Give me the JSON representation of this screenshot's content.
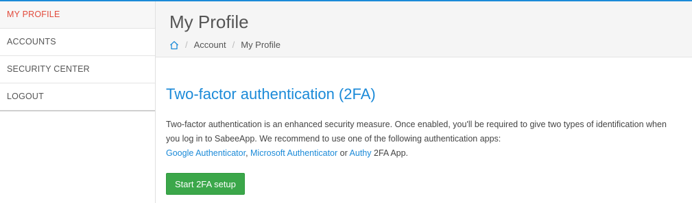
{
  "sidebar": {
    "items": [
      {
        "label": "MY PROFILE",
        "active": true
      },
      {
        "label": "ACCOUNTS",
        "active": false
      },
      {
        "label": "SECURITY CENTER",
        "active": false
      },
      {
        "label": "LOGOUT",
        "active": false
      }
    ]
  },
  "header": {
    "title": "My Profile",
    "breadcrumb": {
      "home_icon": "home-icon",
      "separator": "/",
      "items": [
        "Account",
        "My Profile"
      ]
    }
  },
  "section": {
    "title": "Two-factor authentication (2FA)",
    "description_line1": "Two-factor authentication is an enhanced security measure. Once enabled, you'll be required to give two types of identification when you log in to SabeeApp. We recommend to use one of the following authentication apps:",
    "apps": [
      "Google Authenticator",
      "Microsoft Authenticator",
      "Authy"
    ],
    "app_separator": ", ",
    "or_text": " or ",
    "suffix": " 2FA App.",
    "button_label": "Start 2FA setup"
  },
  "colors": {
    "accent": "#1b8ad8",
    "active_nav": "#e24a3b",
    "button_bg": "#3ba74a"
  }
}
